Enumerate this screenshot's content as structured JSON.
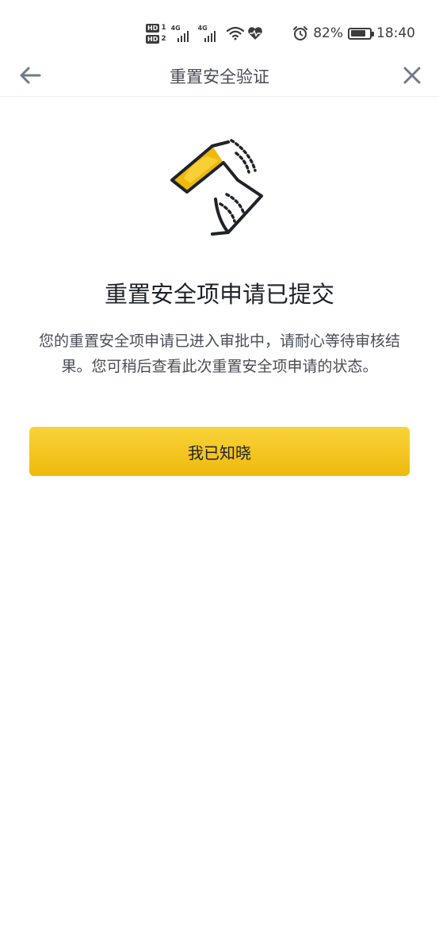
{
  "status_bar": {
    "hd1_label": "HD",
    "hd1_num": "1",
    "hd2_label": "HD",
    "hd2_num": "2",
    "signal1_tech": "4G",
    "signal2_tech": "4G",
    "battery_percent_text": "82%",
    "battery_level": 0.82,
    "time": "18:40",
    "icons": [
      "wifi-icon",
      "heart-icon",
      "alarm-icon",
      "battery-icon"
    ]
  },
  "nav": {
    "title": "重置安全验证",
    "back_icon": "back-arrow-icon",
    "close_icon": "close-icon"
  },
  "main": {
    "illustration_icon": "hourglass-icon",
    "headline": "重置安全项申请已提交",
    "description": "您的重置安全项申请已进入审批中，请耐心等待审核结果。您可稍后查看此次重置安全项申请的状态。",
    "button_label": "我已知晓"
  },
  "colors": {
    "accent": "#F0B90B",
    "title_text": "#1E2329",
    "secondary_text": "#474D57",
    "icon_gray": "#707A8A"
  }
}
